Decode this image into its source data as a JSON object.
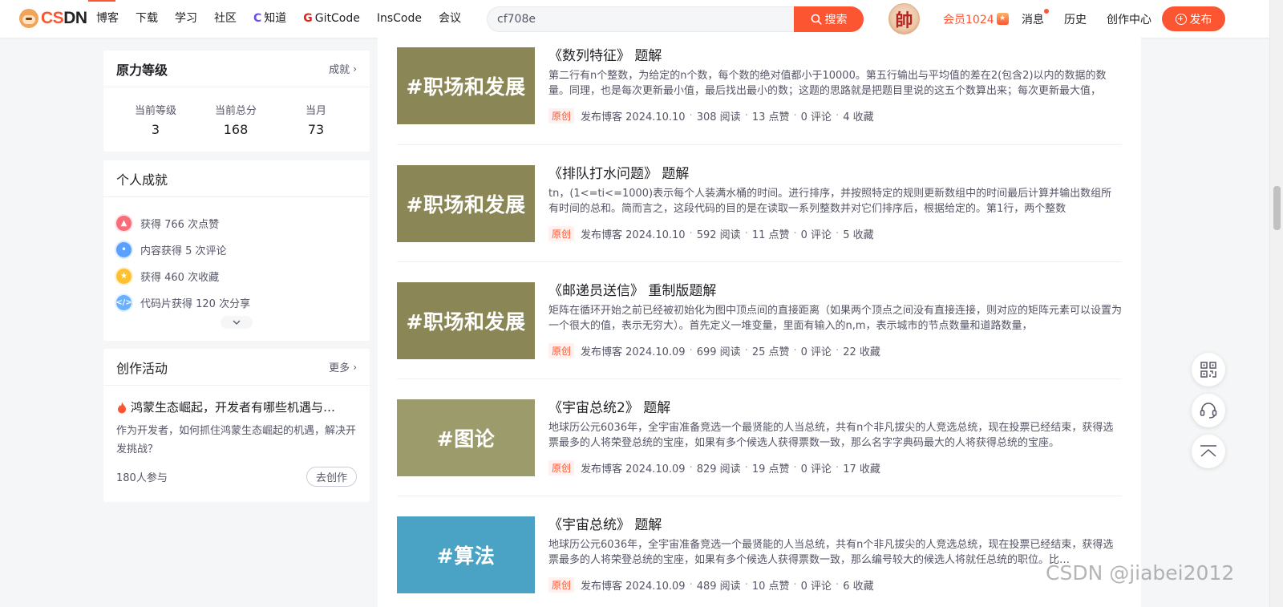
{
  "header": {
    "logo_text": "CSDN",
    "nav": [
      "博客",
      "下载",
      "学习",
      "社区",
      "知道",
      "GitCode",
      "InsCode",
      "会议"
    ],
    "search_value": "cf708e",
    "search_button": "搜索",
    "avatar_char": "帥",
    "vip_label": "会员1024",
    "links": [
      "消息",
      "历史",
      "创作中心"
    ],
    "publish_label": "发布"
  },
  "sidebar": {
    "level": {
      "title": "原力等级",
      "more": "成就",
      "stats": [
        {
          "label": "当前等级",
          "value": "3"
        },
        {
          "label": "当前总分",
          "value": "168"
        },
        {
          "label": "当月",
          "value": "73"
        }
      ]
    },
    "achievements": {
      "title": "个人成就",
      "items": [
        {
          "icon": "like-icon",
          "text": "获得 766 次点赞"
        },
        {
          "icon": "comment-icon",
          "text": "内容获得 5 次评论"
        },
        {
          "icon": "favorite-icon",
          "text": "获得 460 次收藏"
        },
        {
          "icon": "code-icon",
          "text": "代码片获得 120 次分享"
        }
      ]
    },
    "activity": {
      "title": "创作活动",
      "more": "更多",
      "headline": "鸿蒙生态崛起，开发者有哪些机遇与…",
      "desc": "作为开发者，如何抓住鸿蒙生态崛起的机遇，解决开发挑战？",
      "participants": "180人参与",
      "button": "去创作"
    }
  },
  "articles": [
    {
      "thumb_text": "#职场和发展",
      "thumb_color": "#8b8655",
      "title": "《数列特征》 题解",
      "desc": "第二行有n个整数，为给定的n个数，每个数的绝对值都小于10000。第五行输出与平均值的差在2(包含2)以内的数据的数量。同理，也是每次更新最小值，最后找出最小的数；这题的思路就是把题目里说的这五个数算出来；每次更新最大值，",
      "tag": "原创",
      "date": "发布博客 2024.10.10",
      "reads": "308 阅读",
      "likes": "13 点赞",
      "comments": "0 评论",
      "favs": "4 收藏"
    },
    {
      "thumb_text": "#职场和发展",
      "thumb_color": "#8b8655",
      "title": "《排队打水问题》 题解",
      "desc": "tn，(1<=ti<=1000)表示每个人装满水桶的时间。进行排序，并按照特定的规则更新数组中的时间最后计算并输出数组所有时间的总和。简而言之，这段代码的目的是在读取一系列整数并对它们排序后，根据给定的。第1行，两个整数",
      "tag": "原创",
      "date": "发布博客 2024.10.10",
      "reads": "592 阅读",
      "likes": "11 点赞",
      "comments": "0 评论",
      "favs": "5 收藏"
    },
    {
      "thumb_text": "#职场和发展",
      "thumb_color": "#8b8655",
      "title": "《邮递员送信》 重制版题解",
      "desc": "矩阵在循环开始之前已经被初始化为图中顶点间的直接距离（如果两个顶点之间没有直接连接，则对应的矩阵元素可以设置为一个很大的值，表示无穷大）。首先定义一堆变量，里面有输入的n,m，表示城市的节点数量和道路数量，",
      "tag": "原创",
      "date": "发布博客 2024.10.09",
      "reads": "699 阅读",
      "likes": "25 点赞",
      "comments": "0 评论",
      "favs": "22 收藏"
    },
    {
      "thumb_text": "#图论",
      "thumb_color": "#9c9b6c",
      "title": "《宇宙总统2》 题解",
      "desc": "地球历公元6036年，全宇宙准备竞选一个最贤能的人当总统，共有n个非凡拔尖的人竞选总统，现在投票已经结束，获得选票最多的人将荣登总统的宝座，如果有多个候选人获得票数一致，那么名字字典码最大的人将获得总统的宝座。",
      "tag": "原创",
      "date": "发布博客 2024.10.09",
      "reads": "829 阅读",
      "likes": "19 点赞",
      "comments": "0 评论",
      "favs": "17 收藏"
    },
    {
      "thumb_text": "#算法",
      "thumb_color": "#4aa3c5",
      "title": "《宇宙总统》 题解",
      "desc": "地球历公元6036年，全宇宙准备竞选一个最贤能的人当总统，共有n个非凡拔尖的人竞选总统，现在投票已经结束，获得选票最多的人将荣登总统的宝座，如果有多个候选人获得票数一致，那么编号较大的候选人将就任总统的职位。比…",
      "tag": "原创",
      "date": "发布博客 2024.10.09",
      "reads": "489 阅读",
      "likes": "10 点赞",
      "comments": "0 评论",
      "favs": "6 收藏"
    }
  ],
  "float_tools": [
    "qrcode-icon",
    "customer-service-icon",
    "back-to-top-icon"
  ],
  "watermark": "CSDN @jiabei2012"
}
